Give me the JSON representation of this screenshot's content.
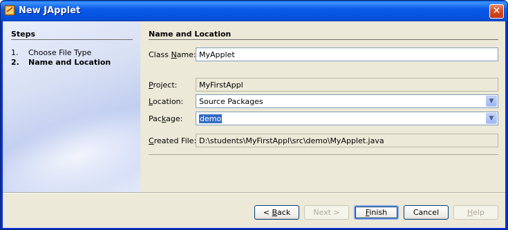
{
  "window": {
    "title": "New JApplet",
    "close_symbol": "✕"
  },
  "steps": {
    "heading": "Steps",
    "items": [
      {
        "number": "1.",
        "label": "Choose File Type"
      },
      {
        "number": "2.",
        "label": "Name and Location"
      }
    ]
  },
  "form": {
    "heading": "Name and Location",
    "class_name": {
      "label_pre": "Class ",
      "label_key": "N",
      "label_post": "ame:",
      "value": "MyApplet"
    },
    "project": {
      "label_key": "P",
      "label_post": "roject:",
      "value": "MyFirstAppl"
    },
    "location": {
      "label_key": "L",
      "label_post": "ocation:",
      "value": "Source Packages"
    },
    "package": {
      "label_pre": "Pac",
      "label_key": "k",
      "label_post": "age:",
      "value": "demo"
    },
    "created_file": {
      "label_key": "C",
      "label_post": "reated File:",
      "value": "D:\\students\\MyFirstAppl\\src\\demo\\MyApplet.java"
    }
  },
  "buttons": {
    "back": {
      "label_pre": "< ",
      "label_key": "B",
      "label_post": "ack"
    },
    "next": {
      "label": "Next >"
    },
    "finish": {
      "label_key": "F",
      "label_post": "inish"
    },
    "cancel": {
      "label": "Cancel"
    },
    "help": {
      "label_key": "H",
      "label_post": "elp"
    }
  },
  "icons": {
    "app_icon": "java-coffee-cup-icon",
    "close": "close-icon",
    "dropdown": "chevron-down-icon"
  }
}
